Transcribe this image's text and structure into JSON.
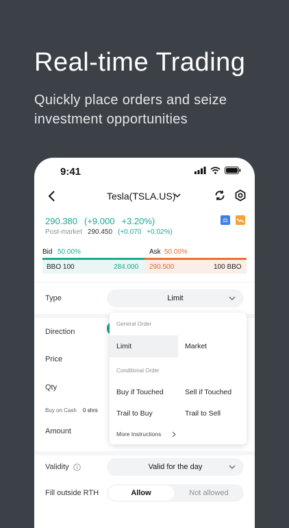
{
  "hero": {
    "title": "Real-time Trading",
    "subtitle": "Quickly place orders and seize investment opportunities"
  },
  "status_bar": {
    "time": "9:41"
  },
  "nav": {
    "title": "Tesla(TSLA.US)"
  },
  "quote": {
    "price": "290.380",
    "change": "(+9.000",
    "change_pct": "+3.20%)",
    "post_label": "Post-market",
    "post_price": "290.450",
    "post_change": "(+0.070",
    "post_pct": "+0.02%)"
  },
  "bid_ask": {
    "bid_label": "Bid",
    "bid_pct": "50.00%",
    "ask_label": "Ask",
    "ask_pct": "50.00%",
    "bid_bbo": "BBO 100",
    "bid_price": "284.000",
    "ask_price": "290.500",
    "ask_bbo": "100 BBO",
    "bid_share": 0.5
  },
  "form": {
    "type_label": "Type",
    "type_value": "Limit",
    "direction_label": "Direction",
    "price_label": "Price",
    "qty_label": "Qty",
    "buy_on_cash_label": "Buy on Cash",
    "buy_on_cash_value": "0 shrs",
    "amount_label": "Amount",
    "validity_label": "Validity",
    "validity_value": "Valid for the day",
    "fill_label": "Fill outside RTH",
    "fill_allow": "Allow",
    "fill_not_allowed": "Not allowed"
  },
  "dropdown": {
    "general_header": "General Order",
    "limit": "Limit",
    "market": "Market",
    "conditional_header": "Conditional Order",
    "buy_if_touched": "Buy if Touched",
    "sell_if_touched": "Sell if Touched",
    "trail_to_buy": "Trail to Buy",
    "trail_to_sell": "Trail to Sell",
    "more": "More Instructions"
  },
  "colors": {
    "up": "#1aa793",
    "down": "#e8722f",
    "background": "#3b4147"
  }
}
